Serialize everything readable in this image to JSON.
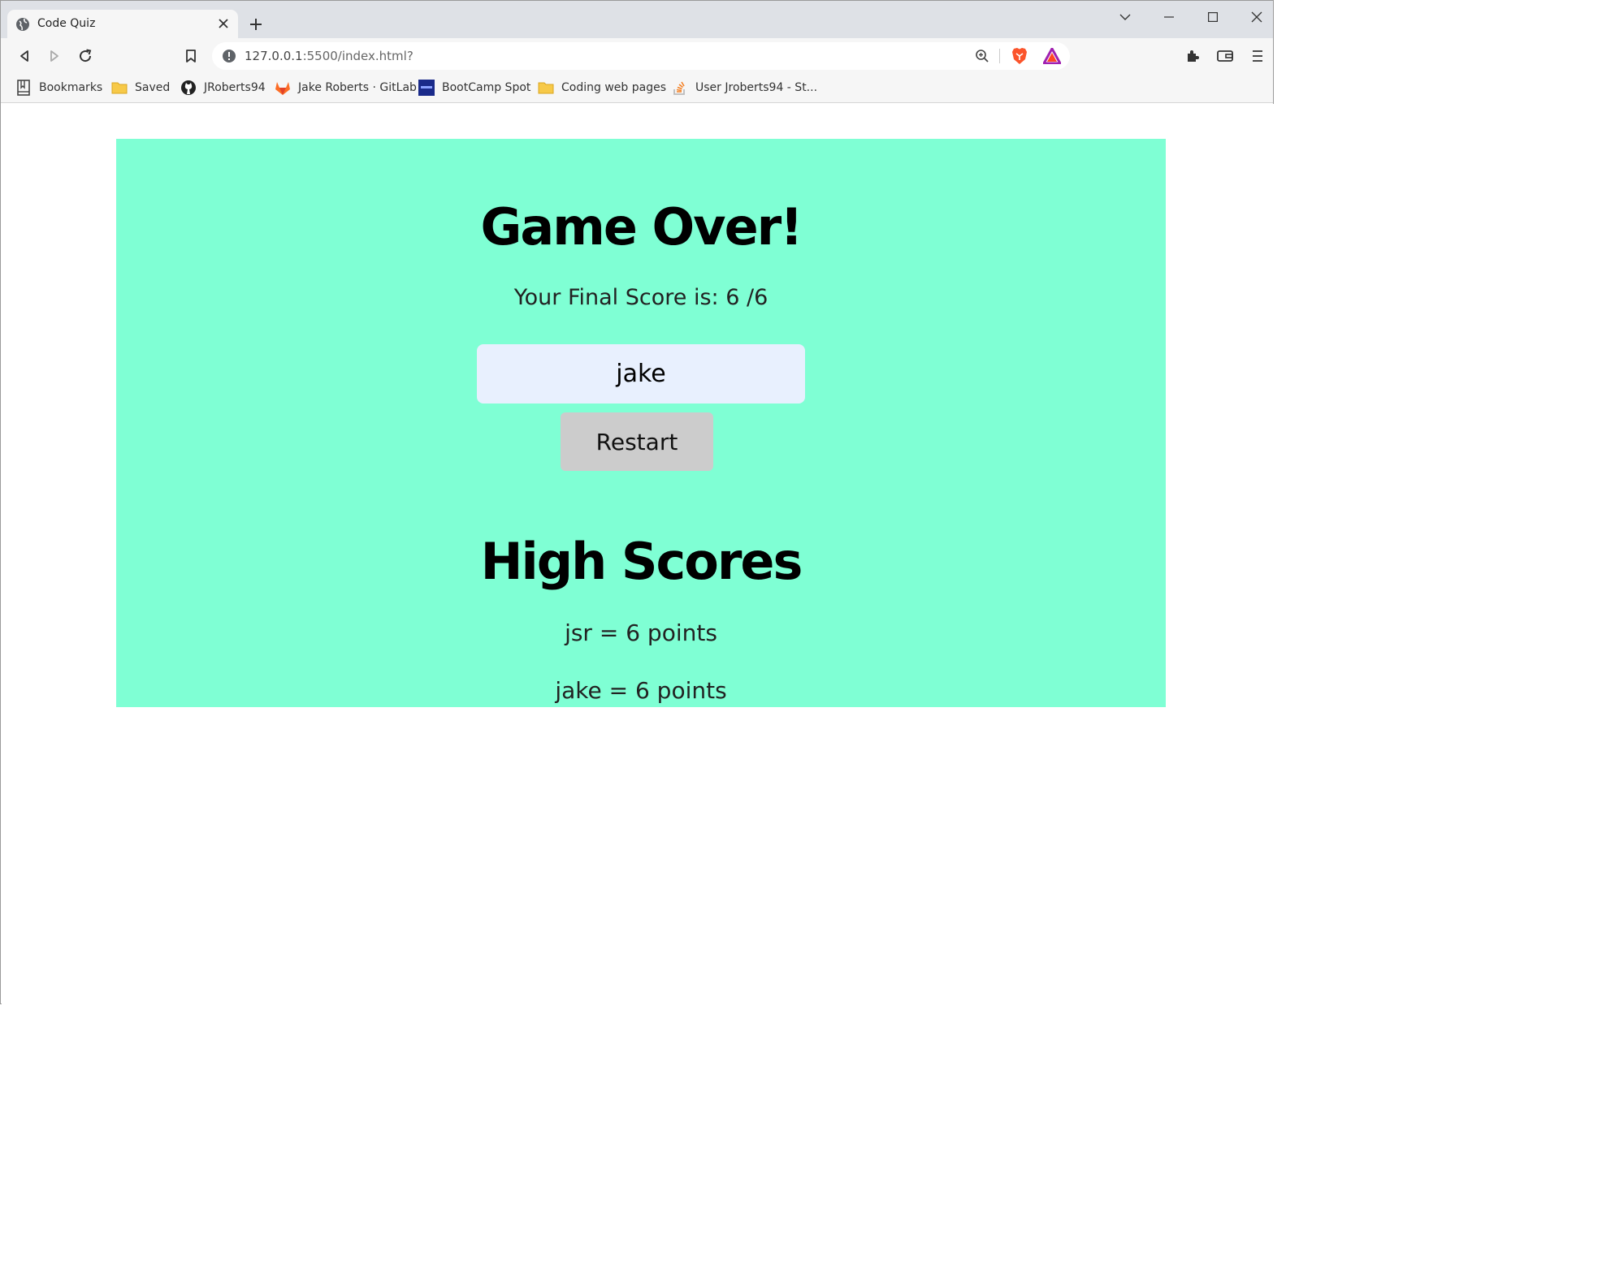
{
  "browser": {
    "tab_title": "Code Quiz",
    "url_host": "127.0.0.1",
    "url_rest": ":5500/index.html?",
    "bookmarks": [
      {
        "label": "Bookmarks",
        "icon": "bookmarks-icon"
      },
      {
        "label": "Saved",
        "icon": "folder-icon"
      },
      {
        "label": "JRoberts94",
        "icon": "github-icon"
      },
      {
        "label": "Jake Roberts · GitLab",
        "icon": "gitlab-icon"
      },
      {
        "label": "BootCamp Spot",
        "icon": "bootcamp-icon"
      },
      {
        "label": "Coding web pages",
        "icon": "folder-icon"
      },
      {
        "label": "User Jroberts94 - St...",
        "icon": "stackoverflow-icon"
      }
    ]
  },
  "page": {
    "game_over_title": "Game Over!",
    "final_score_text": "Your Final Score is: 6 /6",
    "name_value": "jake",
    "restart_label": "Restart",
    "high_scores_title": "High Scores",
    "high_scores": [
      "jsr = 6 points",
      "jake = 6 points"
    ]
  },
  "colors": {
    "card_background": "#7fffd4",
    "input_background": "#e8f0fe",
    "button_background": "#cccccc"
  }
}
